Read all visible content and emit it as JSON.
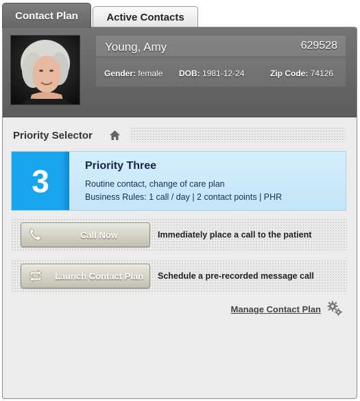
{
  "tabs": [
    {
      "label": "Contact Plan",
      "active": true
    },
    {
      "label": "Active Contacts",
      "active": false
    }
  ],
  "patient": {
    "name": "Young, Amy",
    "id": "629528",
    "gender_label": "Gender:",
    "gender": "female",
    "dob_label": "DOB:",
    "dob": "1981-12-24",
    "zip_label": "Zip Code:",
    "zip": "74126"
  },
  "priority_selector": {
    "title": "Priority Selector",
    "level": "3",
    "name": "Priority Three",
    "description": "Routine contact, change of care plan",
    "rules": "Business Rules: 1 call / day | 2 contact points | PHR",
    "accent_color": "#19a4ee"
  },
  "actions": [
    {
      "label": "Call Now",
      "icon": "phone-icon",
      "description": "Immediately place a call to the patient"
    },
    {
      "label": "Launch Contact Plan",
      "icon": "repeat-icon",
      "description": "Schedule a pre-recorded message call"
    }
  ],
  "manage_link": "Manage Contact Plan"
}
